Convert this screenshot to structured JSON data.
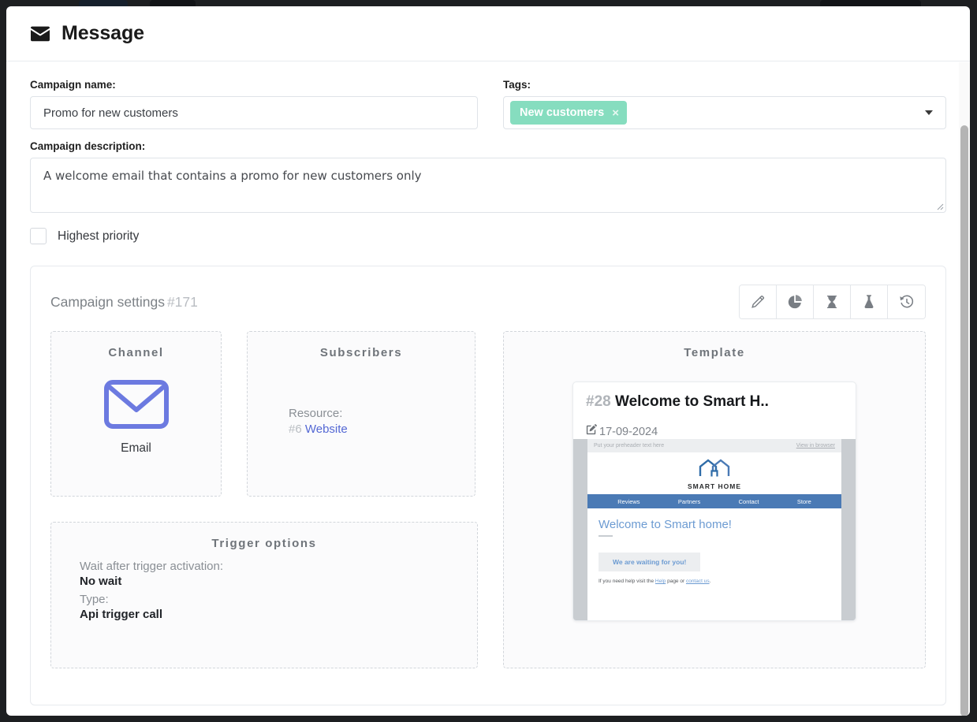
{
  "header": {
    "title": "Message",
    "icon": "envelope-icon"
  },
  "form": {
    "campaign_name_label": "Campaign name:",
    "campaign_name_value": "Promo for new customers",
    "tags_label": "Tags:",
    "tags": [
      {
        "label": "New customers",
        "color": "#86ddbf",
        "remove_icon": "×"
      }
    ],
    "tags_caret_icon": "chevron-down-icon",
    "description_label": "Campaign description:",
    "description_value": "A welcome email that contains a promo for new customers only",
    "priority_checkbox_label": "Highest priority",
    "priority_checked": false
  },
  "settings": {
    "title": "Campaign settings",
    "id": "#171",
    "toolbar": [
      {
        "name": "edit-pencil-icon",
        "title": "Edit"
      },
      {
        "name": "pie-chart-icon",
        "title": "Statistics"
      },
      {
        "name": "hourglass-icon",
        "title": "Schedule"
      },
      {
        "name": "flask-icon",
        "title": "A/B test"
      },
      {
        "name": "history-clock-icon",
        "title": "History"
      }
    ],
    "channel": {
      "title": "Channel",
      "icon": "envelope-outline-icon",
      "icon_color": "#6c7ae0",
      "label": "Email"
    },
    "subscribers": {
      "title": "Subscribers",
      "resource_label": "Resource:",
      "resource_id": "#6",
      "resource_name": "Website",
      "resource_link_color": "#5468d4"
    },
    "trigger": {
      "title": "Trigger options",
      "wait_label": "Wait after trigger activation:",
      "wait_value": "No wait",
      "type_label": "Type:",
      "type_value": "Api trigger call"
    },
    "template": {
      "title": "Template",
      "id": "#28",
      "name": "Welcome to Smart H..",
      "date_icon": "edit-square-icon",
      "date": "17-09-2024",
      "preview": {
        "preheader_text": "Put your preheader text here",
        "view_in_browser": "View in browser",
        "logo_text": "SMART HOME",
        "nav": [
          "Reviews",
          "Partners",
          "Contact",
          "Store"
        ],
        "nav_color": "#4a7ab5",
        "heading": "Welcome to Smart home!",
        "heading_color": "#6c9bd2",
        "button_text": "We are waiting for you!",
        "footer_prefix": "If you need help visit the ",
        "footer_link_1": "Help",
        "footer_middle": " page or ",
        "footer_link_2": "contact us",
        "footer_suffix": "."
      }
    }
  }
}
